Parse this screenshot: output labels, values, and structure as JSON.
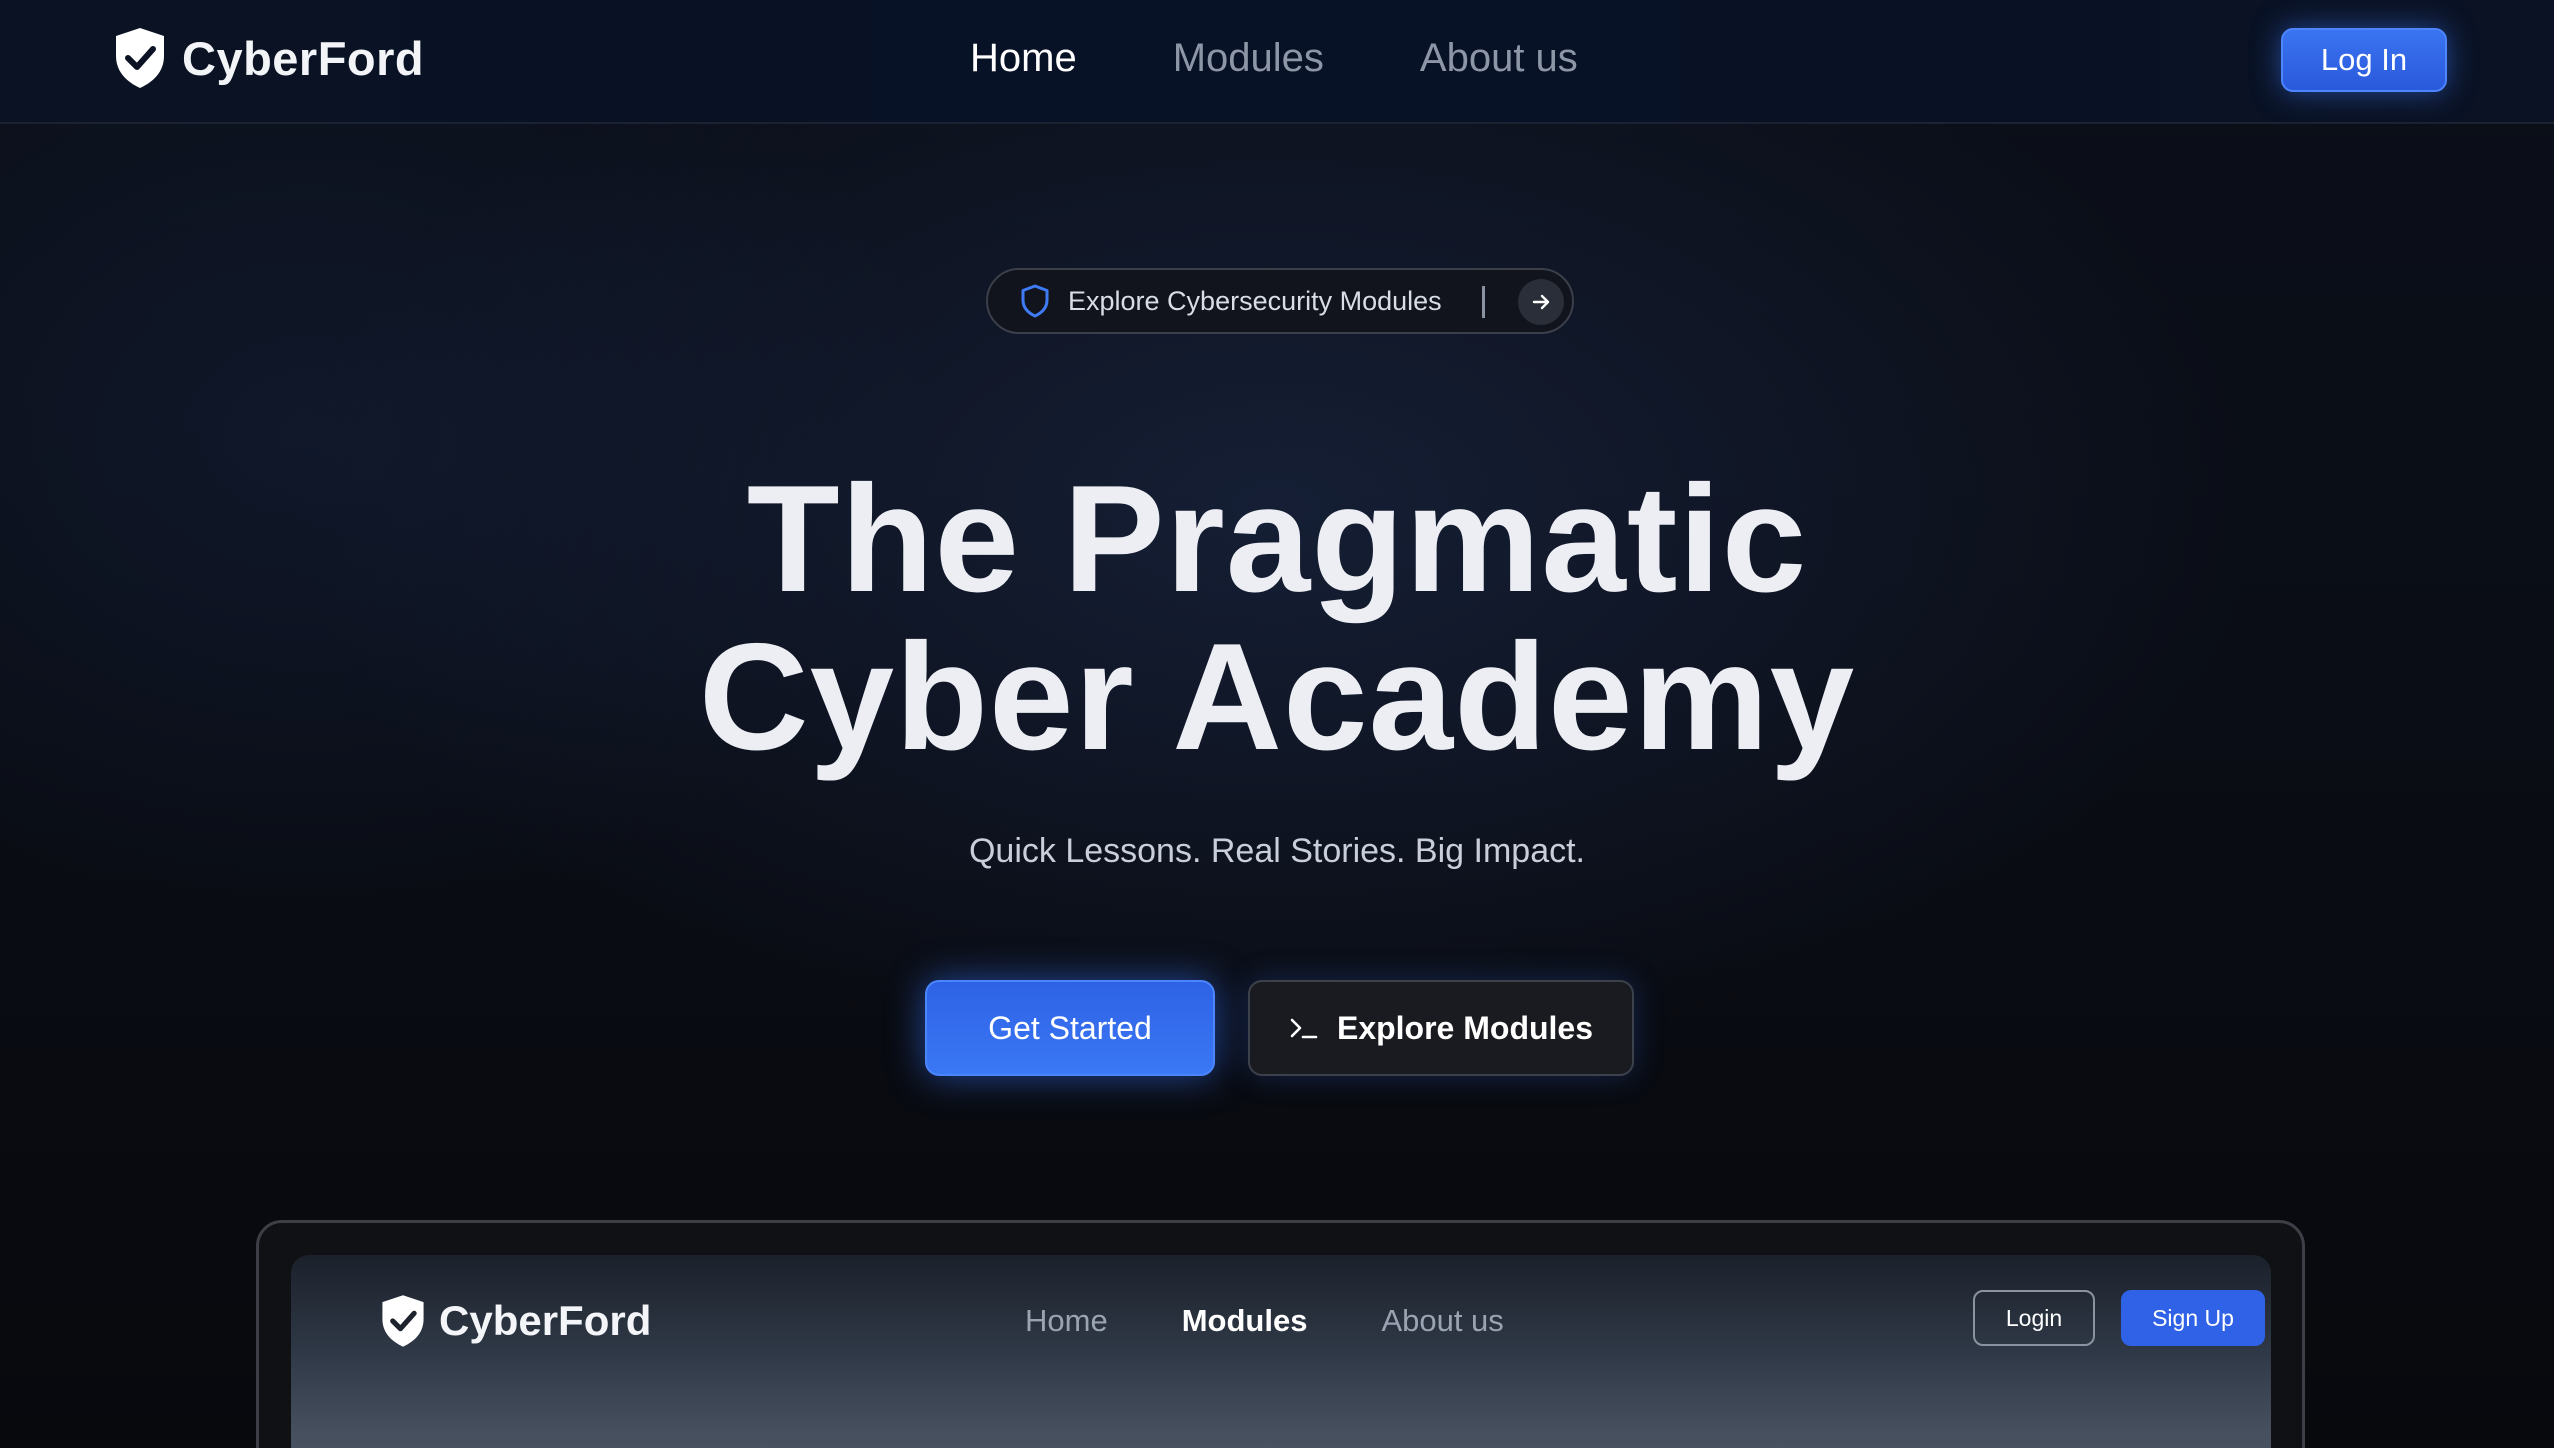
{
  "colors": {
    "accent": "#2f62e6",
    "background": "#090b11",
    "text": "#eceef4"
  },
  "nav": {
    "brand": "CyberFord",
    "brand_icon": "shield-check-icon",
    "links": [
      {
        "label": "Home",
        "active": true
      },
      {
        "label": "Modules",
        "active": false
      },
      {
        "label": "About us",
        "active": false
      }
    ],
    "login_label": "Log In"
  },
  "hero": {
    "pill_icon": "shield-icon",
    "pill_text": "Explore Cybersecurity Modules",
    "pill_arrow_icon": "arrow-right-icon",
    "title_line1": "The Pragmatic",
    "title_line2": "Cyber Academy",
    "subtitle": "Quick Lessons. Real Stories. Big Impact.",
    "primary_button": "Get Started",
    "secondary_button": "Explore Modules",
    "secondary_icon": "terminal-icon"
  },
  "preview": {
    "brand": "CyberFord",
    "links": [
      {
        "label": "Home",
        "active": false
      },
      {
        "label": "Modules",
        "active": true
      },
      {
        "label": "About us",
        "active": false
      }
    ],
    "login_label": "Login",
    "signup_label": "Sign Up"
  }
}
